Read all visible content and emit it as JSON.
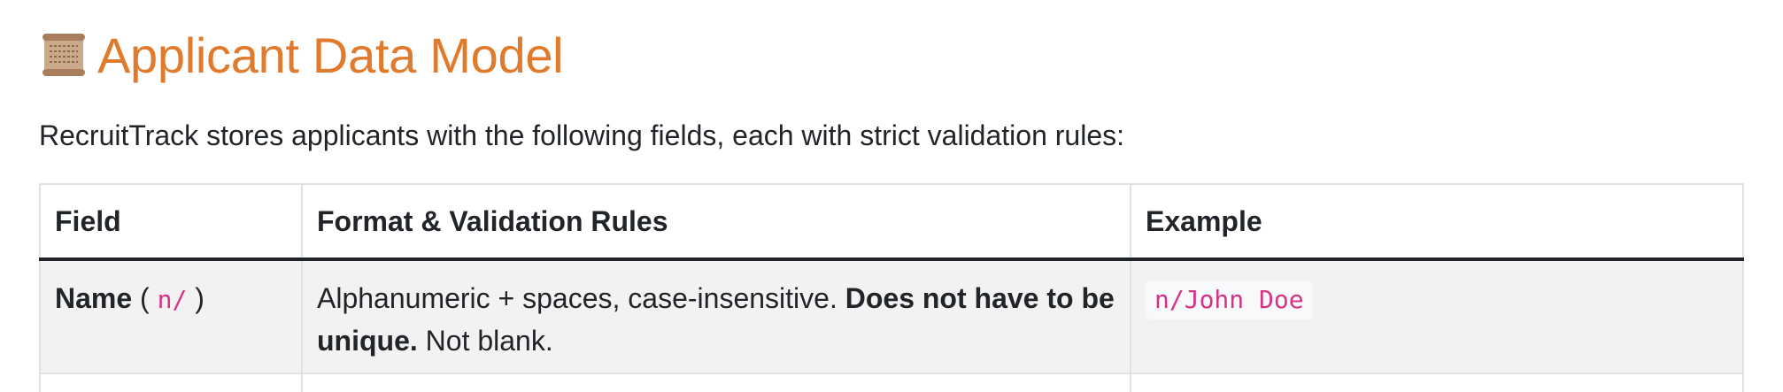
{
  "heading": {
    "icon": "scroll-icon",
    "title": "Applicant Data Model"
  },
  "intro": "RecruitTrack stores applicants with the following fields, each with strict validation rules:",
  "table": {
    "headers": [
      "Field",
      "Format & Validation Rules",
      "Example"
    ],
    "rows": [
      {
        "field_label": "Name",
        "field_open": "(",
        "field_prefix": "n/",
        "field_close": ")",
        "rules_pre": "Alphanumeric + spaces, case-insensitive.",
        "rules_bold": "Does not have to be unique.",
        "rules_post": "Not blank.",
        "example": "n/John Doe"
      }
    ]
  },
  "colors": {
    "heading": "#e07a2c",
    "code": "#d63384",
    "row_bg": "#f2f2f2"
  }
}
